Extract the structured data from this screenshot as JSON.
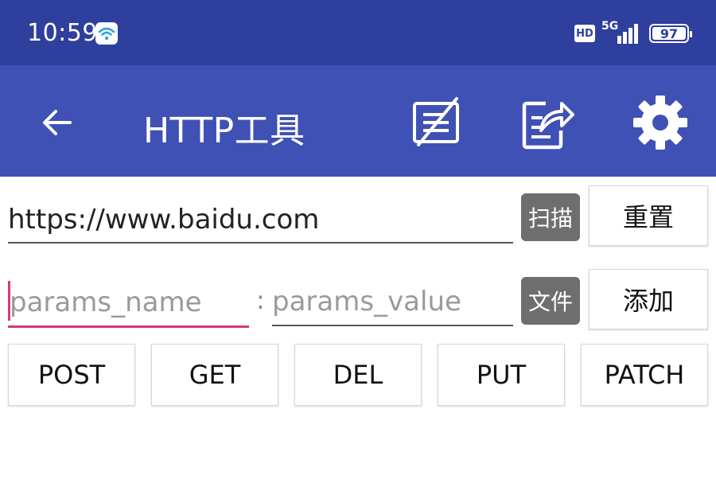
{
  "status_bar": {
    "time": "10:59",
    "hd_label": "HD",
    "network_label": "5G",
    "battery_level": "97"
  },
  "app_bar": {
    "title": "HTTP工具",
    "icons": [
      "back-arrow-icon",
      "edit-note-icon",
      "share-icon",
      "settings-gear-icon"
    ]
  },
  "url": {
    "value": "https://www.baidu.com",
    "scan_label": "扫描",
    "reset_label": "重置"
  },
  "params": {
    "name_placeholder": "params_name",
    "separator": ":",
    "value_placeholder": "params_value",
    "file_label": "文件",
    "add_label": "添加"
  },
  "methods": [
    "POST",
    "GET",
    "DEL",
    "PUT",
    "PATCH"
  ],
  "colors": {
    "status_bar": "#2f3f9d",
    "app_bar": "#3f51b5",
    "accent": "#d6397f",
    "small_button": "#6e6e6e"
  }
}
